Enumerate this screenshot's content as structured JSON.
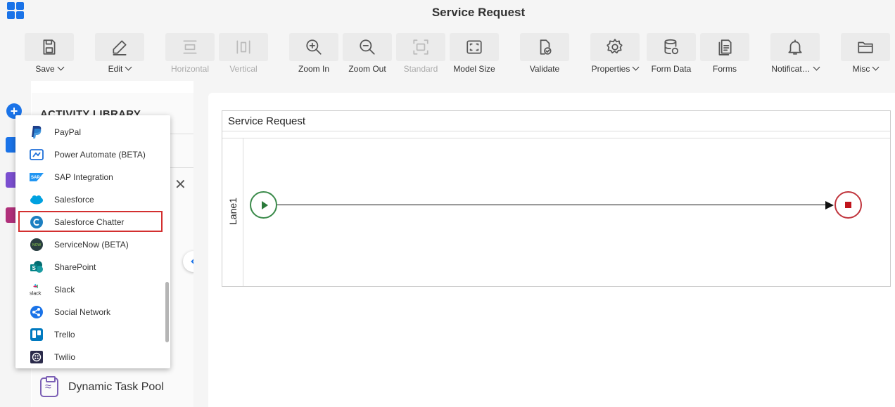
{
  "app": {
    "title": "Service Request"
  },
  "toolbar": {
    "items": [
      {
        "label": "Save",
        "icon": "save-icon",
        "dropdown": true,
        "enabled": true
      },
      {
        "label": "Edit",
        "icon": "pencil-icon",
        "dropdown": true,
        "enabled": true
      },
      {
        "label": "Horizontal",
        "icon": "horizontal-layout-icon",
        "dropdown": false,
        "enabled": false
      },
      {
        "label": "Vertical",
        "icon": "vertical-layout-icon",
        "dropdown": false,
        "enabled": false
      },
      {
        "label": "Zoom In",
        "icon": "zoom-in-icon",
        "dropdown": false,
        "enabled": true
      },
      {
        "label": "Zoom Out",
        "icon": "zoom-out-icon",
        "dropdown": false,
        "enabled": true
      },
      {
        "label": "Standard",
        "icon": "standard-size-icon",
        "dropdown": false,
        "enabled": false
      },
      {
        "label": "Model Size",
        "icon": "model-size-icon",
        "dropdown": false,
        "enabled": true
      },
      {
        "label": "Validate",
        "icon": "validate-icon",
        "dropdown": false,
        "enabled": true
      },
      {
        "label": "Properties",
        "icon": "gear-icon",
        "dropdown": true,
        "enabled": true
      },
      {
        "label": "Form Data",
        "icon": "database-icon",
        "dropdown": false,
        "enabled": true
      },
      {
        "label": "Forms",
        "icon": "forms-icon",
        "dropdown": false,
        "enabled": true
      },
      {
        "label": "Notificat…",
        "icon": "bell-icon",
        "dropdown": true,
        "enabled": true
      },
      {
        "label": "Misc",
        "icon": "folder-icon",
        "dropdown": true,
        "enabled": true
      }
    ]
  },
  "library": {
    "title": "ACTIVITY LIBRARY",
    "visible_item": "Dynamic Task Pool"
  },
  "dropdown": {
    "items": [
      {
        "label": "PayPal",
        "icon": "paypal-icon",
        "color": "#1e3f8a"
      },
      {
        "label": "Power Automate (BETA)",
        "icon": "power-automate-icon",
        "color": "#1e6fd9"
      },
      {
        "label": "SAP Integration",
        "icon": "sap-icon",
        "color": "#2196f3"
      },
      {
        "label": "Salesforce",
        "icon": "salesforce-icon",
        "color": "#00a1e0"
      },
      {
        "label": "Salesforce Chatter",
        "icon": "salesforce-chatter-icon",
        "color": "#1c7fc1"
      },
      {
        "label": "ServiceNow (BETA)",
        "icon": "servicenow-icon",
        "color": "#293e40"
      },
      {
        "label": "SharePoint",
        "icon": "sharepoint-icon",
        "color": "#038387"
      },
      {
        "label": "Slack",
        "icon": "slack-icon",
        "color": "#4a154b"
      },
      {
        "label": "Social Network",
        "icon": "social-network-icon",
        "color": "#1a73e8"
      },
      {
        "label": "Trello",
        "icon": "trello-icon",
        "color": "#0079bf"
      },
      {
        "label": "Twilio",
        "icon": "twilio-icon",
        "color": "#2b2b4b"
      }
    ],
    "selected": "Salesforce Chatter"
  },
  "canvas": {
    "pool_title": "Service Request",
    "lane_label": "Lane1"
  }
}
